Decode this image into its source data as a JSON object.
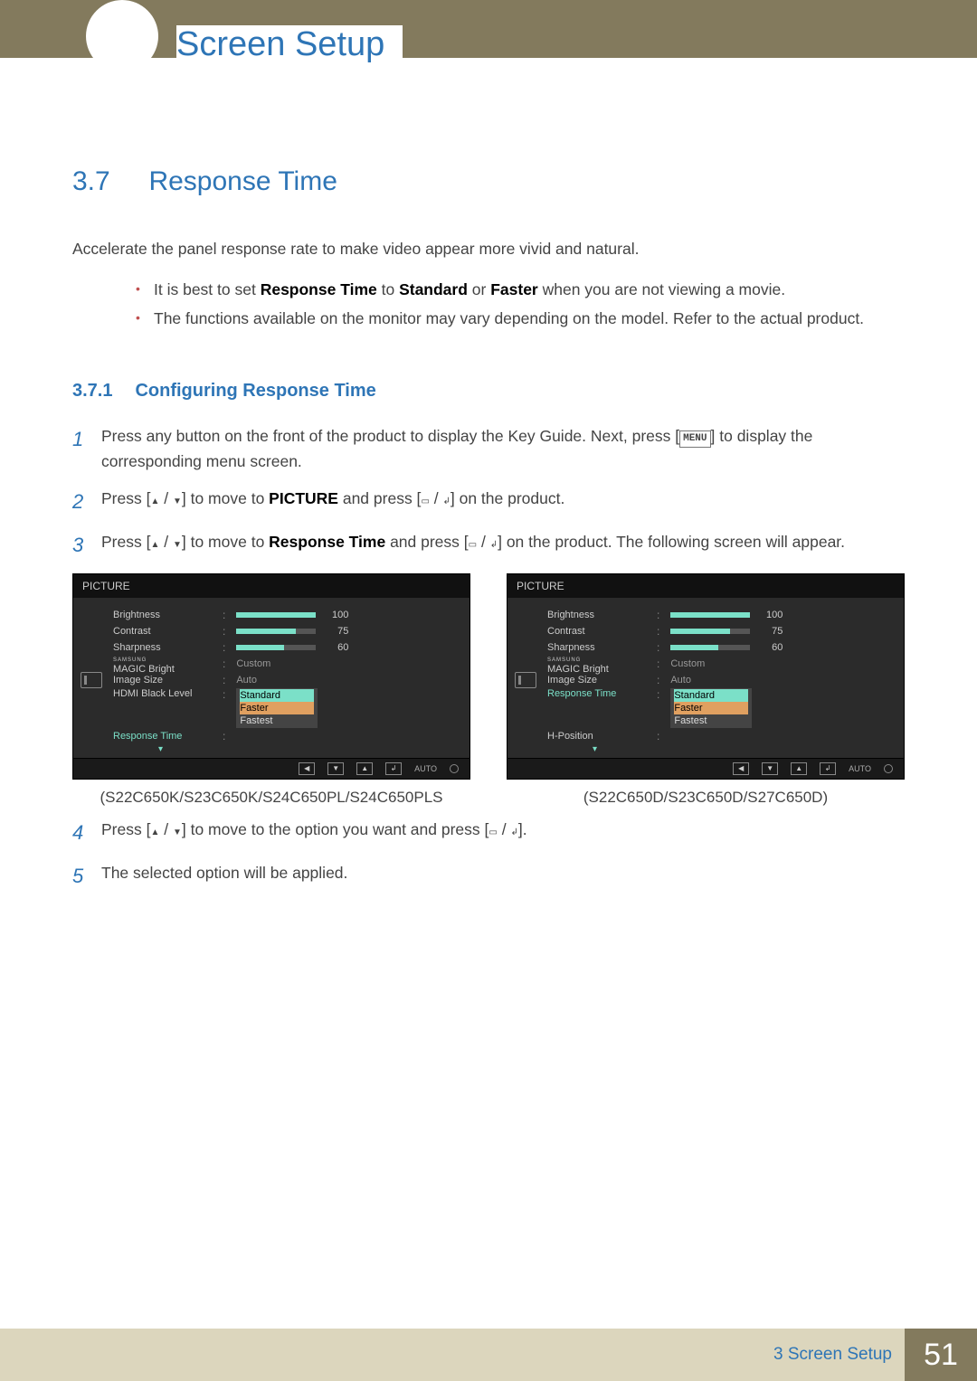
{
  "header": {
    "chapter_title": "Screen Setup"
  },
  "section": {
    "number": "3.7",
    "title": "Response Time",
    "intro": "Accelerate the panel response rate to make video appear more vivid and natural.",
    "bullets": [
      {
        "pre": "It is best to set ",
        "b1": "Response Time",
        "mid1": " to ",
        "b2": "Standard",
        "mid2": " or ",
        "b3": "Faster",
        "post": " when you are not viewing a movie."
      },
      {
        "full": "The functions available on the monitor may vary depending on the model. Refer to the actual product."
      }
    ]
  },
  "subsection": {
    "number": "3.7.1",
    "title": "Configuring Response Time"
  },
  "steps": {
    "s1": {
      "pre": "Press any button on the front of the product to display the Key Guide. Next, press [",
      "menu": "MENU",
      "post": "] to display the corresponding menu screen."
    },
    "s2": {
      "pre": "Press [",
      "mid": "] to move to ",
      "b1": "PICTURE",
      "mid2": " and press [",
      "post": "] on the product."
    },
    "s3": {
      "pre": "Press [",
      "mid": "] to move to ",
      "b1": "Response Time",
      "mid2": " and press [",
      "post": "] on the product. The following screen will appear."
    },
    "s4": {
      "pre": "Press [",
      "mid": "] to move to the option you want and press [",
      "post": "]."
    },
    "s5": "The selected option will be applied."
  },
  "osd": {
    "title": "PICTURE",
    "brightness_label": "Brightness",
    "contrast_label": "Contrast",
    "sharpness_label": "Sharpness",
    "magic_small": "SAMSUNG",
    "magic_label": "MAGIC",
    "magic_bright": " Bright",
    "imagesize_label": "Image Size",
    "hdmi_label": "HDMI Black Level",
    "response_label": "Response Time",
    "hposition_label": "H-Position",
    "custom": "Custom",
    "auto_val": "Auto",
    "brightness_val": "100",
    "contrast_val": "75",
    "sharpness_val": "60",
    "opt_standard": "Standard",
    "opt_faster": "Faster",
    "opt_fastest": "Fastest",
    "footer_auto": "AUTO"
  },
  "captions": {
    "left": "(S22C650K/S23C650K/S24C650PL/S24C650PLS",
    "right": "(S22C650D/S23C650D/S27C650D)"
  },
  "footer": {
    "text": "3 Screen Setup",
    "page": "51"
  }
}
